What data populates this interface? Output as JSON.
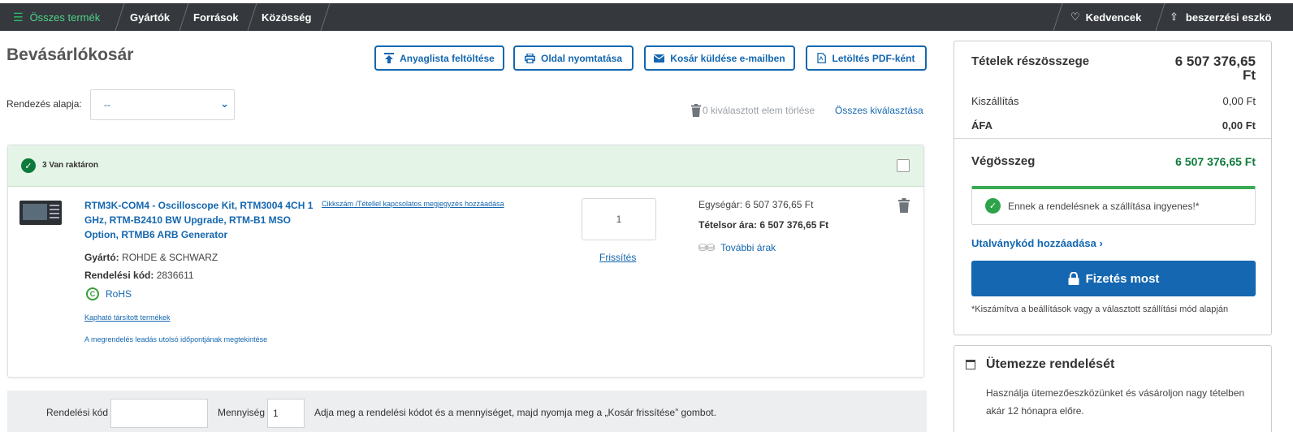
{
  "nav": {
    "all_products": "Összes termék",
    "manufacturers": "Gyártók",
    "resources": "Források",
    "community": "Közösség",
    "favorites": "Kedvencek",
    "procurement": "beszerzési eszkö"
  },
  "page": {
    "title": "Bevásárlókosár"
  },
  "actions": {
    "upload_bom": "Anyaglista feltöltése",
    "print_page": "Oldal nyomtatása",
    "email_cart": "Kosár küldése e-mailben",
    "download_pdf": "Letöltés PDF-ként"
  },
  "sort": {
    "label": "Rendezés alapja:",
    "selected": "--"
  },
  "selection": {
    "delete_selected": "0 kiválasztott elem törlése",
    "select_all": "Összes kiválasztása"
  },
  "stock": {
    "label": "3 Van raktáron"
  },
  "item": {
    "title": "RTM3K-COM4 - Oscilloscope Kit, RTM3004 4CH 1 GHz, RTM-B2410 BW Upgrade, RTM-B1 MSO Option, RTMB6 ARB Generator",
    "note_link": "Cikkszám /Tétellel kapcsolatos megjegyzés hozzáadása",
    "manufacturer_label": "Gyártó:",
    "manufacturer": "ROHDE & SCHWARZ",
    "order_code_label": "Rendelési kód:",
    "order_code": "2836611",
    "rohs": "RoHS",
    "related_link": "Kapható társított termékek",
    "cutoff_link": "A megrendelés leadás utolsó időpontjának megtekintése",
    "quantity": "1",
    "refresh": "Frissítés",
    "unit_price_label": "Egységár:",
    "unit_price": "6 507 376,65 Ft",
    "line_price_label": "Tételsor ára:",
    "line_price": "6 507 376,65 Ft",
    "more_prices": "További árak"
  },
  "quick_order": {
    "code_label": "Rendelési kód",
    "code_value": "",
    "qty_label": "Mennyiség",
    "qty_value": "1",
    "hint": "Adja meg a rendelési kódot és a mennyiséget, majd nyomja meg a „Kosár frissítése” gombot."
  },
  "summary": {
    "subtotal_label": "Tételek részösszege",
    "subtotal_amount": "6 507 376,65",
    "subtotal_currency": "Ft",
    "shipping_label": "Kiszállítás",
    "shipping": "0,00 Ft",
    "vat_label": "ÁFA",
    "vat": "0,00 Ft",
    "total_label": "Végösszeg",
    "total": "6 507 376,65 Ft",
    "free_shipping": "Ennek a rendelésnek a szállítása ingyenes!*",
    "voucher": "Utalványkód hozzáadása",
    "checkout": "Fizetés most",
    "footnote": "*Kiszámítva a beállítások vagy a választott szállítási mód alapján"
  },
  "schedule": {
    "title": "Ütemezze rendelését",
    "description": "Használja ütemezőeszközünket és vásároljon nagy tételben akár 12 hónapra előre."
  },
  "colors": {
    "nav_bg": "#35393d",
    "brand_blue": "#1467b0",
    "stock_green_bg": "#e4f5e7",
    "total_green": "#0d7a3c"
  }
}
